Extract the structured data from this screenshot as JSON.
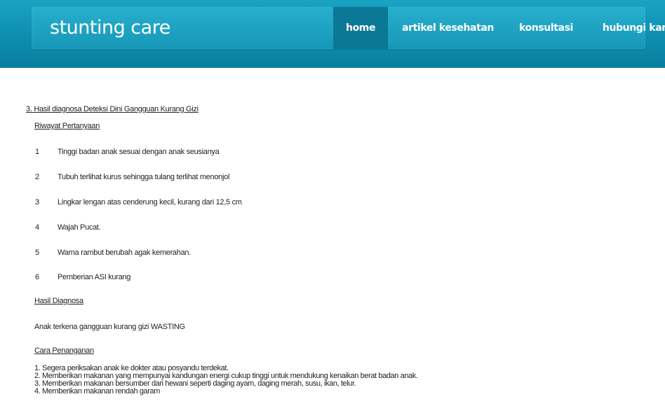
{
  "header": {
    "brand": "stunting care",
    "nav": [
      {
        "label": "home",
        "active": true
      },
      {
        "label": "artikel kesehatan",
        "active": false
      },
      {
        "label": "konsultasi",
        "active": false
      },
      {
        "label": "hubungi kami",
        "active": false
      }
    ],
    "colors": {
      "header_bg": "#0e8eb0",
      "active_nav_bg": "#0b7895",
      "text": "#ffffff"
    }
  },
  "main": {
    "section_title": "3. Hasil diagnosa Deteksi Dini Gangguan Kurang Gizi",
    "riwayat_heading": "Riwayat Pertanyaan",
    "questions": [
      {
        "no": "1",
        "text": "Tinggi badan anak sesuai dengan anak seusianya"
      },
      {
        "no": "2",
        "text": "Tubuh terlihat kurus sehingga tulang terlihat menonjol"
      },
      {
        "no": "3",
        "text": "Lingkar lengan atas cenderung kecil, kurang dari 12,5 cm"
      },
      {
        "no": "4",
        "text": "Wajah Pucat."
      },
      {
        "no": "5",
        "text": "Warna rambut berubah agak kemerahan."
      },
      {
        "no": "6",
        "text": "Pemberian ASI kurang"
      }
    ],
    "hasil_heading": "Hasil Diagnosa",
    "hasil_text": "Anak terkena gangguan kurang gizi WASTING",
    "penanganan_heading": "Cara Penanganan",
    "penanganan_steps": [
      "1. Segera periksakan anak ke dokter atau posyandu terdekat.",
      "2. Memberikan makanan yang mempunyai kandungan energi cukup tinggi untuk mendukung kenaikan berat badan anak.",
      "3. Memberikan makanan bersumber dari hewani seperti daging ayam, daging merah, susu, ikan, telur.",
      "4. Memberikan makanan rendah garam"
    ]
  }
}
